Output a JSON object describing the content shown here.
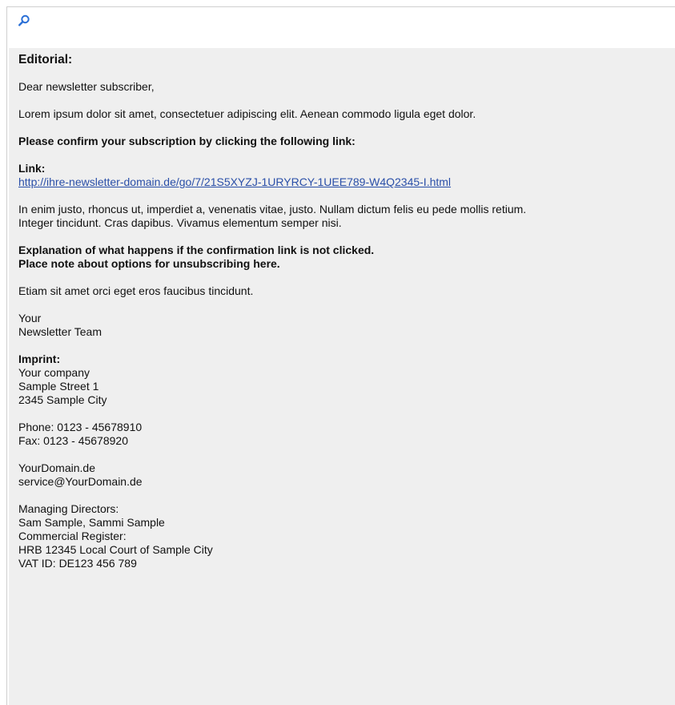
{
  "toolbar": {
    "zoom_icon": "magnifier-icon"
  },
  "newsletter": {
    "heading": "Editorial:",
    "greeting": "Dear newsletter subscriber,",
    "intro": "Lorem ipsum dolor sit amet, consectetuer adipiscing elit. Aenean commodo ligula eget dolor.",
    "confirm_prompt": "Please confirm your subscription by clicking the following link:",
    "link_label": "Link:",
    "link_url": "http://ihre-newsletter-domain.de/go/7/21S5XYZJ-1URYRCY-1UEE789-W4Q2345-I.html",
    "body_line1": "In enim justo, rhoncus ut, imperdiet a, venenatis vitae, justo. Nullam dictum felis eu pede mollis retium.",
    "body_line2": "Integer tincidunt. Cras dapibus. Vivamus elementum semper nisi.",
    "explanation_line1": "Explanation of what happens if the confirmation link is not clicked.",
    "explanation_line2": "Place note about options for unsubscribing here.",
    "closing_text": "Etiam sit amet orci eget eros faucibus tincidunt.",
    "signoff_line1": "Your",
    "signoff_line2": "Newsletter Team"
  },
  "imprint": {
    "label": "Imprint:",
    "company": "Your company",
    "street": "Sample Street 1",
    "city": "2345 Sample City",
    "phone": "Phone: 0123 - 45678910",
    "fax": "Fax: 0123 - 45678920",
    "domain": "YourDomain.de",
    "email": "service@YourDomain.de",
    "directors_label": "Managing Directors:",
    "directors": "Sam Sample, Sammi Sample",
    "register_label": "Commercial Register:",
    "register": "HRB 12345 Local Court of Sample City",
    "vat": "VAT ID: DE123 456 789"
  }
}
